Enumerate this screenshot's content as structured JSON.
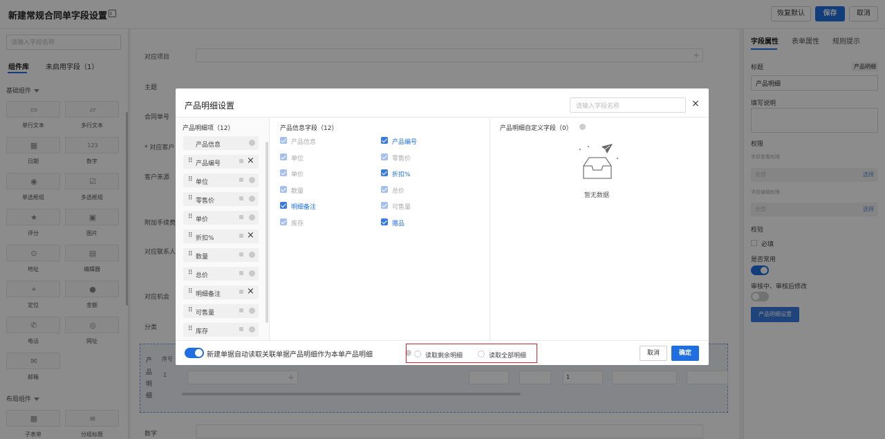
{
  "header": {
    "title": "新建常规合同单字段设置",
    "restore_label": "恢复默认",
    "save_label": "保存",
    "cancel_label": "取消"
  },
  "left": {
    "search_placeholder": "请输入字段名称",
    "tabs": [
      "组件库",
      "未启用字段（1）"
    ],
    "basic_section": "基础组件",
    "layout_section": "布局组件",
    "components": [
      {
        "label": "单行文本",
        "icon": "single-line-text-icon"
      },
      {
        "label": "多行文本",
        "icon": "multi-line-text-icon"
      },
      {
        "label": "日期",
        "icon": "calendar-icon"
      },
      {
        "label": "数字",
        "icon": "number-icon"
      },
      {
        "label": "单选框组",
        "icon": "radio-icon"
      },
      {
        "label": "多选框组",
        "icon": "checkbox-icon"
      },
      {
        "label": "评分",
        "icon": "star-icon"
      },
      {
        "label": "图片",
        "icon": "image-icon"
      },
      {
        "label": "地址",
        "icon": "location-pin-icon"
      },
      {
        "label": "编辑器",
        "icon": "editor-icon"
      },
      {
        "label": "定位",
        "icon": "locate-icon"
      },
      {
        "label": "金额",
        "icon": "money-icon"
      },
      {
        "label": "电话",
        "icon": "phone-icon"
      },
      {
        "label": "网址",
        "icon": "globe-icon"
      },
      {
        "label": "邮箱",
        "icon": "mail-icon"
      }
    ],
    "layout_components": [
      {
        "label": "子表单",
        "icon": "table-icon"
      },
      {
        "label": "分组标题",
        "icon": "group-title-icon"
      }
    ]
  },
  "form": {
    "fields": [
      "对应项目",
      "主题",
      "合同单号",
      "* 对应客户",
      "客户来源",
      "附加手续费",
      "对应联系人",
      "对应机会",
      "分类",
      "数字"
    ],
    "detail_vertical": [
      "产",
      "品",
      "明",
      "细"
    ],
    "detail_col_index": "序号",
    "detail_row_index": "1",
    "detail_value_1": "1"
  },
  "right": {
    "tabs": [
      "字段属性",
      "表单属性",
      "规则提示"
    ],
    "title_label": "标题",
    "title_badge": "产品明细",
    "title_value": "产品明细",
    "desc_label": "填写说明",
    "perm_label": "权限",
    "view_perm_label": "字段查看权限",
    "view_perm_value": "全部",
    "view_perm_link": "选择",
    "edit_perm_label": "字段编辑权限",
    "edit_perm_value": "全部",
    "edit_perm_link": "选择",
    "verify_label": "校验",
    "required_label": "必填",
    "common_label": "是否常用",
    "audit_label": "审核中、审核后修改",
    "settings_button": "产品明细设置",
    "common_on": true,
    "audit_on": false
  },
  "modal": {
    "title": "产品明细设置",
    "search_placeholder": "请输入字段名称",
    "items_header": "产品明细项（12）",
    "items": [
      {
        "label": "产品信息",
        "locked": false,
        "removable": false,
        "draggable": false
      },
      {
        "label": "产品编号",
        "locked": true,
        "removable": true,
        "draggable": true
      },
      {
        "label": "单位",
        "locked": true,
        "removable": false,
        "draggable": true
      },
      {
        "label": "零售价",
        "locked": true,
        "removable": false,
        "draggable": true
      },
      {
        "label": "单价",
        "locked": true,
        "removable": false,
        "draggable": true
      },
      {
        "label": "折扣%",
        "locked": true,
        "removable": true,
        "draggable": true
      },
      {
        "label": "数量",
        "locked": true,
        "removable": false,
        "draggable": true
      },
      {
        "label": "总价",
        "locked": true,
        "removable": false,
        "draggable": true
      },
      {
        "label": "明细备注",
        "locked": true,
        "removable": true,
        "draggable": true
      },
      {
        "label": "可售量",
        "locked": true,
        "removable": false,
        "draggable": true
      },
      {
        "label": "库存",
        "locked": true,
        "removable": false,
        "draggable": true
      }
    ],
    "info_header": "产品信息字段（12）",
    "info_fields": [
      {
        "label": "产品信息",
        "enabled": false
      },
      {
        "label": "产品编号",
        "enabled": true
      },
      {
        "label": "单位",
        "enabled": false
      },
      {
        "label": "零售价",
        "enabled": false
      },
      {
        "label": "单价",
        "enabled": false
      },
      {
        "label": "折扣%",
        "enabled": true
      },
      {
        "label": "数量",
        "enabled": false
      },
      {
        "label": "总价",
        "enabled": false
      },
      {
        "label": "明细备注",
        "enabled": true
      },
      {
        "label": "可售量",
        "enabled": false
      },
      {
        "label": "库存",
        "enabled": false
      },
      {
        "label": "赠品",
        "enabled": true
      }
    ],
    "custom_header": "产品明细自定义字段（0）",
    "empty_text": "暂无数据",
    "auto_read_text": "新建单据自动读取关联单据产品明细作为本单产品明细",
    "radio_remaining": "读取剩余明细",
    "radio_all": "读取全部明细",
    "cancel_label": "取消",
    "ok_label": "确定"
  }
}
